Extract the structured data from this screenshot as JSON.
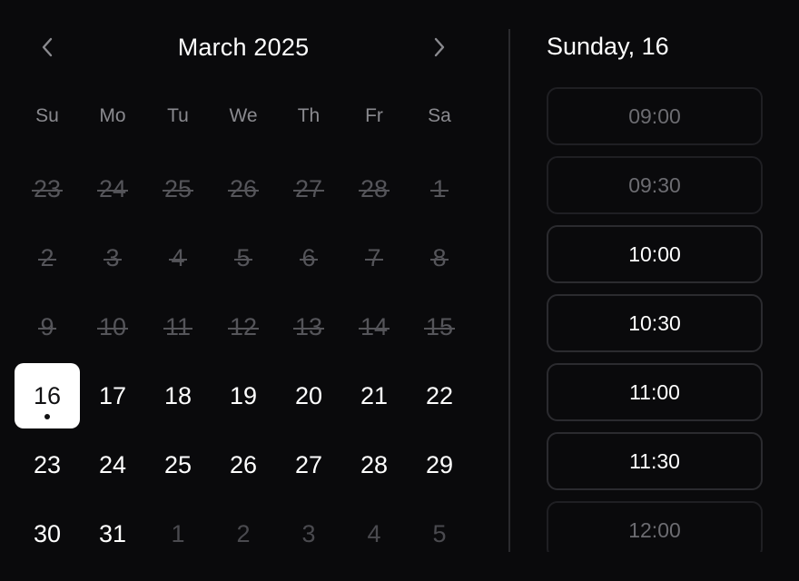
{
  "calendar": {
    "month_label": "March 2025",
    "prev_icon": "chevron-left-icon",
    "next_icon": "chevron-right-icon",
    "weekdays": [
      "Su",
      "Mo",
      "Tu",
      "We",
      "Th",
      "Fr",
      "Sa"
    ],
    "days": [
      {
        "label": "23",
        "state": "disabled"
      },
      {
        "label": "24",
        "state": "disabled"
      },
      {
        "label": "25",
        "state": "disabled"
      },
      {
        "label": "26",
        "state": "disabled"
      },
      {
        "label": "27",
        "state": "disabled"
      },
      {
        "label": "28",
        "state": "disabled"
      },
      {
        "label": "1",
        "state": "disabled"
      },
      {
        "label": "2",
        "state": "disabled"
      },
      {
        "label": "3",
        "state": "disabled"
      },
      {
        "label": "4",
        "state": "disabled"
      },
      {
        "label": "5",
        "state": "disabled"
      },
      {
        "label": "6",
        "state": "disabled"
      },
      {
        "label": "7",
        "state": "disabled"
      },
      {
        "label": "8",
        "state": "disabled"
      },
      {
        "label": "9",
        "state": "disabled"
      },
      {
        "label": "10",
        "state": "disabled"
      },
      {
        "label": "11",
        "state": "disabled"
      },
      {
        "label": "12",
        "state": "disabled"
      },
      {
        "label": "13",
        "state": "disabled"
      },
      {
        "label": "14",
        "state": "disabled"
      },
      {
        "label": "15",
        "state": "disabled"
      },
      {
        "label": "16",
        "state": "selected",
        "today": true
      },
      {
        "label": "17",
        "state": "available"
      },
      {
        "label": "18",
        "state": "available"
      },
      {
        "label": "19",
        "state": "available"
      },
      {
        "label": "20",
        "state": "available"
      },
      {
        "label": "21",
        "state": "available"
      },
      {
        "label": "22",
        "state": "available"
      },
      {
        "label": "23",
        "state": "available"
      },
      {
        "label": "24",
        "state": "available"
      },
      {
        "label": "25",
        "state": "available"
      },
      {
        "label": "26",
        "state": "available"
      },
      {
        "label": "27",
        "state": "available"
      },
      {
        "label": "28",
        "state": "available"
      },
      {
        "label": "29",
        "state": "available"
      },
      {
        "label": "30",
        "state": "available"
      },
      {
        "label": "31",
        "state": "available"
      },
      {
        "label": "1",
        "state": "outside"
      },
      {
        "label": "2",
        "state": "outside"
      },
      {
        "label": "3",
        "state": "outside"
      },
      {
        "label": "4",
        "state": "outside"
      },
      {
        "label": "5",
        "state": "outside"
      }
    ]
  },
  "time_panel": {
    "selected_date_label": "Sunday, 16",
    "slots": [
      {
        "label": "09:00",
        "available": false
      },
      {
        "label": "09:30",
        "available": false
      },
      {
        "label": "10:00",
        "available": true
      },
      {
        "label": "10:30",
        "available": true
      },
      {
        "label": "11:00",
        "available": true
      },
      {
        "label": "11:30",
        "available": true
      },
      {
        "label": "12:00",
        "available": false
      }
    ]
  },
  "colors": {
    "background": "#0a0a0c",
    "selected_day_bg": "#ffffff",
    "muted_text": "#8a8a8f",
    "disabled_text": "#55555a",
    "slot_border": "#2b2b2f"
  }
}
